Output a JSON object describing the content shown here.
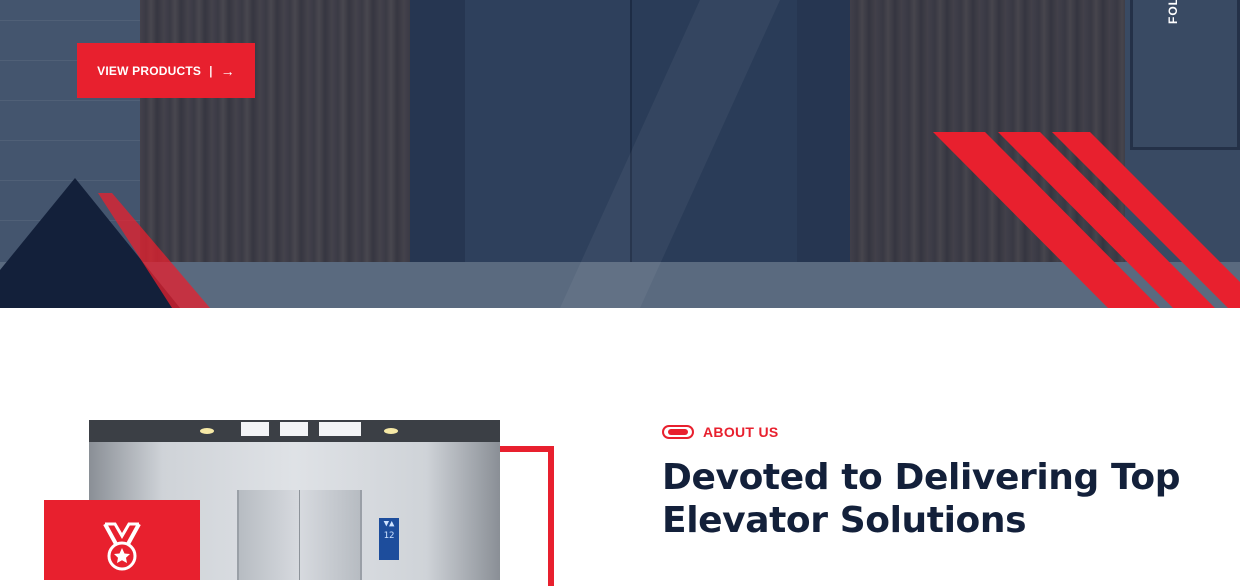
{
  "hero": {
    "cta_label": "VIEW PRODUCTS",
    "cta_separator": "|",
    "cta_arrow": "→",
    "follow_text": "FOLLOW",
    "colors": {
      "accent": "#e8202e",
      "navy": "#13203a"
    }
  },
  "about": {
    "section_label": "ABOUT US",
    "heading": "Devoted to Delivering Top Elevator Solutions",
    "badge_icon": "medal-icon",
    "elevator_display": "12"
  }
}
